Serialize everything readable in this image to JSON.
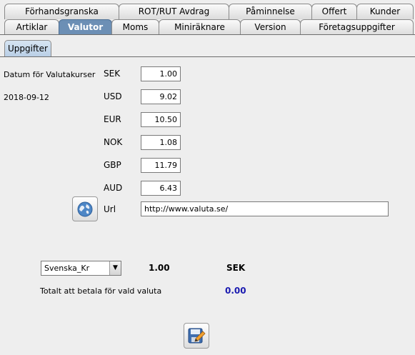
{
  "tabs_row1": [
    {
      "label": "Förhandsgranska"
    },
    {
      "label": "ROT/RUT Avdrag"
    },
    {
      "label": "Påminnelse"
    },
    {
      "label": "Offert"
    },
    {
      "label": "Kunder"
    }
  ],
  "tabs_row2": [
    {
      "label": "Artiklar"
    },
    {
      "label": "Valutor",
      "active": true
    },
    {
      "label": "Moms"
    },
    {
      "label": "Miniräknare"
    },
    {
      "label": "Version"
    },
    {
      "label": "Företagsuppgifter"
    }
  ],
  "subtab": {
    "label": "Uppgifter"
  },
  "rates": {
    "date_label": "Datum för Valutakurser",
    "date_value": "2018-09-12",
    "items": [
      {
        "code": "SEK",
        "value": "1.00"
      },
      {
        "code": "USD",
        "value": "9.02"
      },
      {
        "code": "EUR",
        "value": "10.50"
      },
      {
        "code": "NOK",
        "value": "1.08"
      },
      {
        "code": "GBP",
        "value": "11.79"
      },
      {
        "code": "AUD",
        "value": "6.43"
      }
    ],
    "url_label": "Url",
    "url_value": "http://www.valuta.se/"
  },
  "converter": {
    "selected": "Svenska_Kr",
    "rate": "1.00",
    "code": "SEK",
    "total_label": "Totalt att betala för vald valuta",
    "total_value": "0.00",
    "total_color": "#1a1ab0"
  },
  "icons": {
    "globe": "globe-icon",
    "save": "save-icon"
  }
}
